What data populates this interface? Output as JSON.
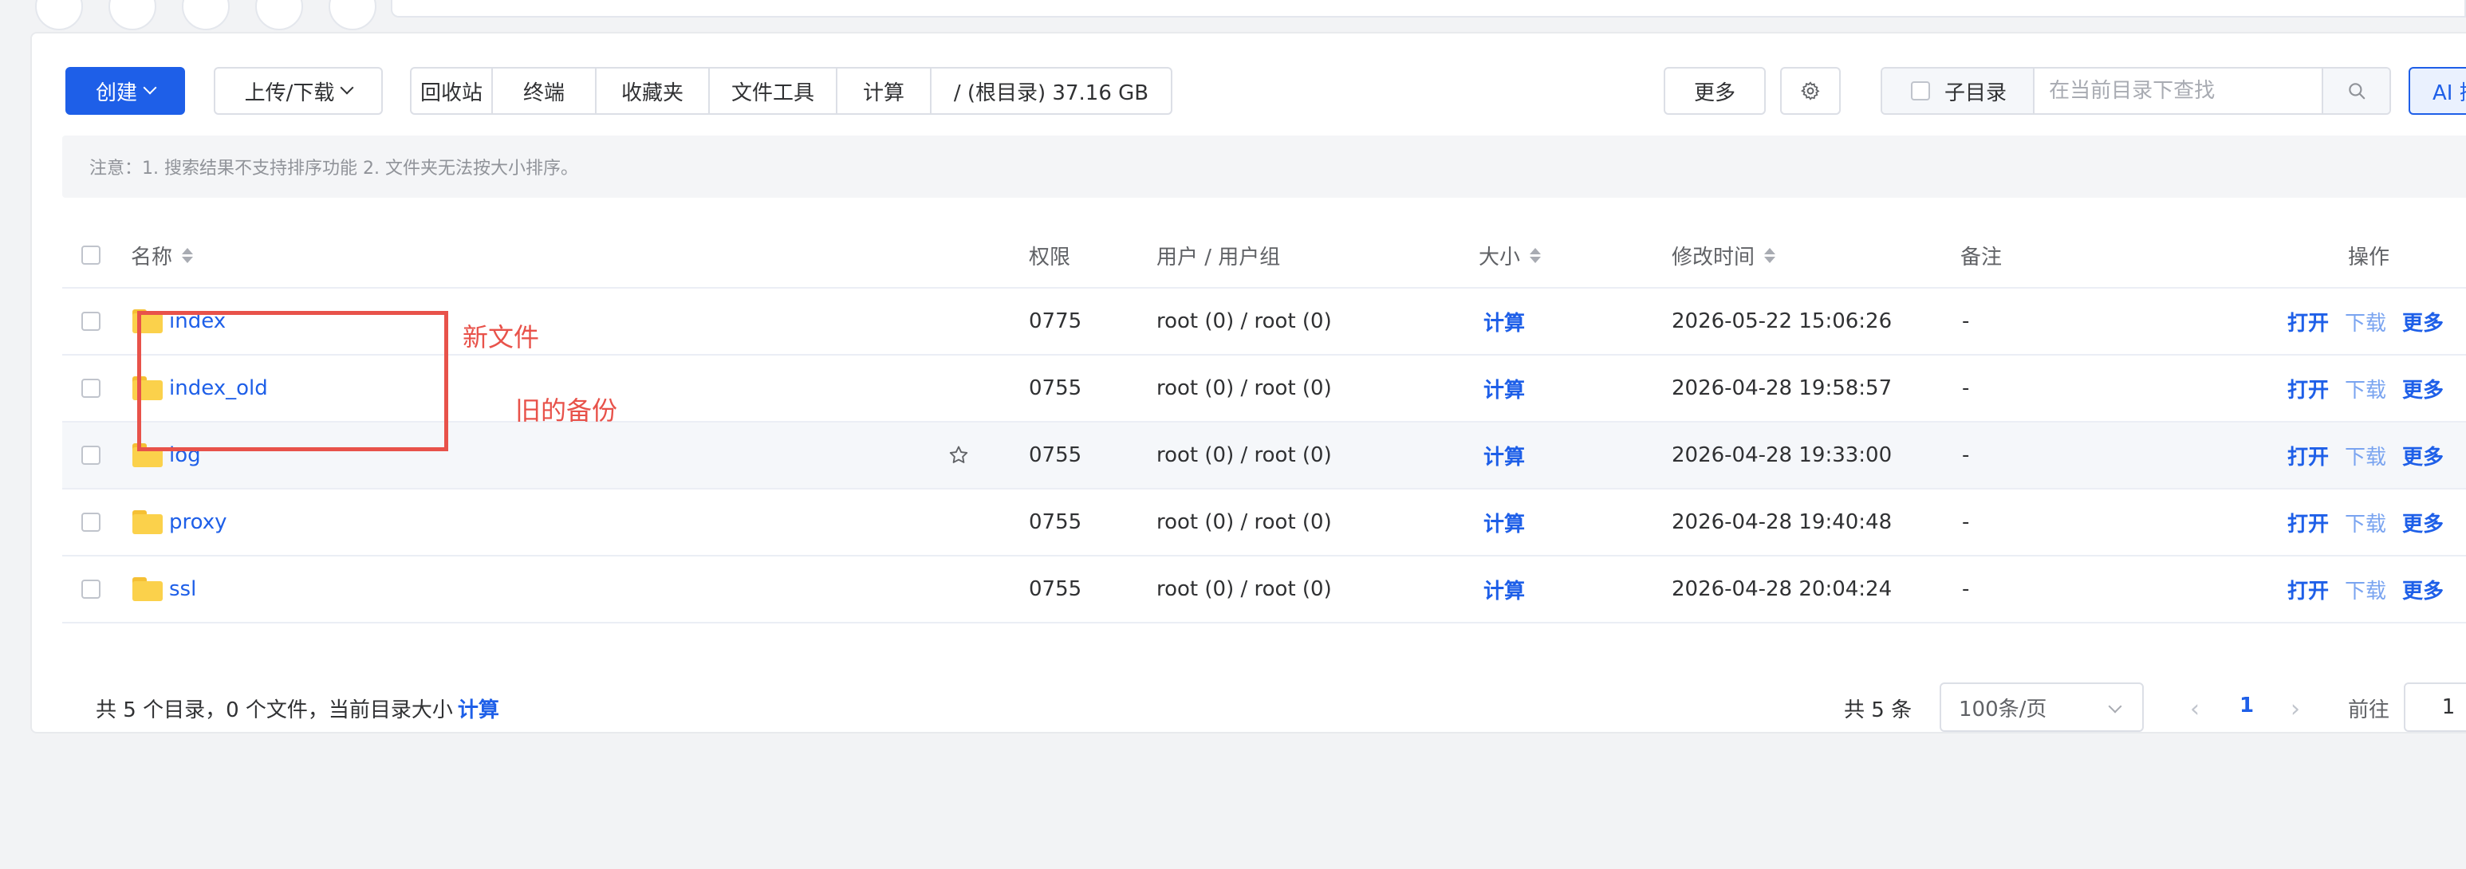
{
  "toolbar": {
    "create_label": "创建",
    "upload_label": "上传/下载",
    "group": [
      "回收站",
      "终端",
      "收藏夹",
      "文件工具",
      "计算",
      "/ (根目录) 37.16 GB"
    ],
    "more_label": "更多",
    "subdir_label": "子目录",
    "search_placeholder": "在当前目录下查找",
    "ai_search_label": "AI 搜索"
  },
  "notice": "注意：1. 搜索结果不支持排序功能 2. 文件夹无法按大小排序。",
  "table": {
    "headers": {
      "name": "名称",
      "perm": "权限",
      "owner": "用户 / 用户组",
      "size": "大小",
      "mtime": "修改时间",
      "note": "备注",
      "ops": "操作"
    },
    "rows": [
      {
        "name": "index",
        "perm": "0775",
        "owner": "root (0) / root (0)",
        "size": "计算",
        "mtime": "2026-05-22 15:06:26",
        "note": "-"
      },
      {
        "name": "index_old",
        "perm": "0755",
        "owner": "root (0) / root (0)",
        "size": "计算",
        "mtime": "2026-04-28 19:58:57",
        "note": "-"
      },
      {
        "name": "log",
        "perm": "0755",
        "owner": "root (0) / root (0)",
        "size": "计算",
        "mtime": "2026-04-28 19:33:00",
        "note": "-"
      },
      {
        "name": "proxy",
        "perm": "0755",
        "owner": "root (0) / root (0)",
        "size": "计算",
        "mtime": "2026-04-28 19:40:48",
        "note": "-"
      },
      {
        "name": "ssl",
        "perm": "0755",
        "owner": "root (0) / root (0)",
        "size": "计算",
        "mtime": "2026-04-28 20:04:24",
        "note": "-"
      }
    ],
    "ops": {
      "open": "打开",
      "download": "下载",
      "more": "更多"
    }
  },
  "annotations": {
    "new_file": "新文件",
    "old_backup": "旧的备份"
  },
  "footer": {
    "summary": "共 5 个目录，0 个文件，当前目录大小",
    "calc": "计算",
    "total": "共 5 条",
    "page_size": "100条/页",
    "current_page": "1",
    "goto_label": "前往",
    "goto_value": "1"
  },
  "colors": {
    "primary": "#1e5fe8",
    "annotation": "#e8524a",
    "folder": "#fbd14b"
  }
}
